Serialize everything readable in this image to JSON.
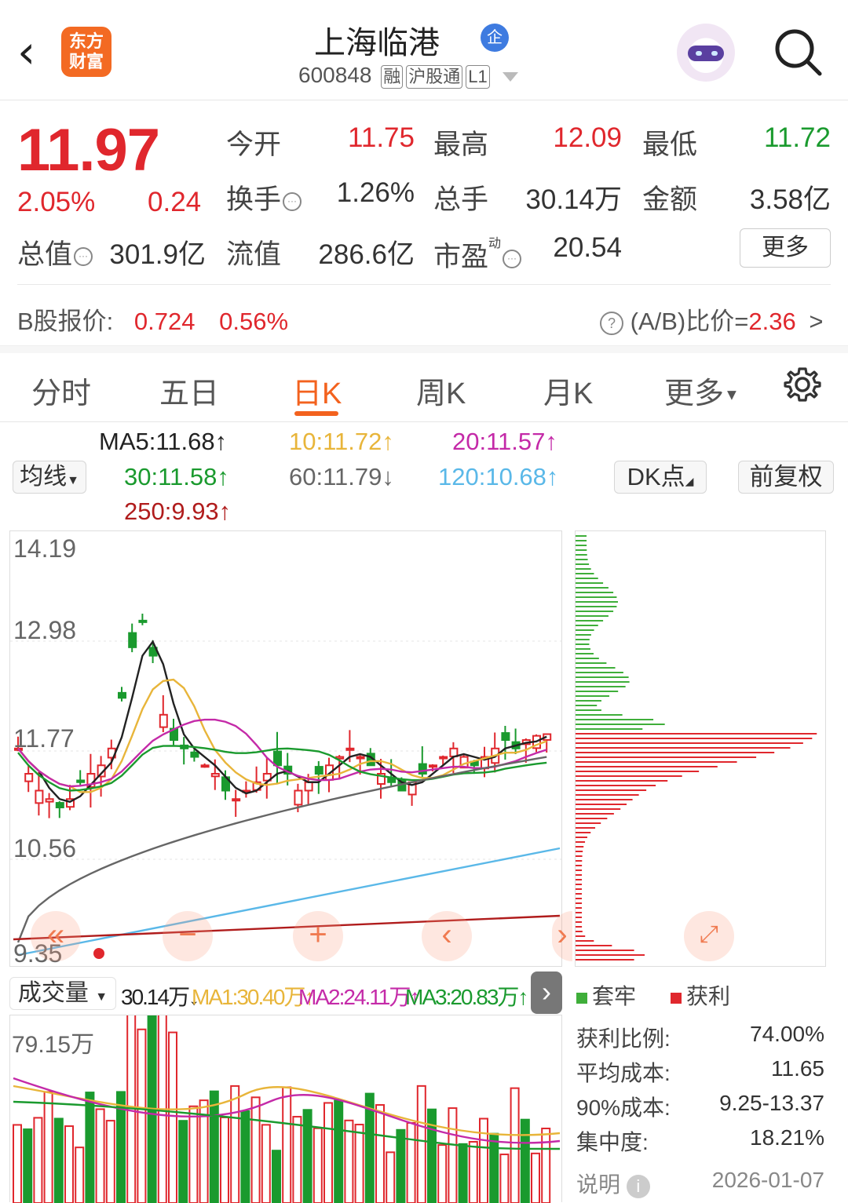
{
  "header": {
    "back_icon": "chevron-left-icon",
    "logo_line1": "东方",
    "logo_line2": "财富",
    "stock_name": "上海临港",
    "qi_badge": "企",
    "code": "600848",
    "tags": [
      "融",
      "沪股通",
      "L1"
    ]
  },
  "quote": {
    "price": "11.97",
    "change_pct": "2.05%",
    "change": "0.24",
    "fields": {
      "open_label": "今开",
      "open": "11.75",
      "high_label": "最高",
      "high": "12.09",
      "low_label": "最低",
      "low": "11.72",
      "turnover_label": "换手",
      "turnover": "1.26%",
      "volume_label": "总手",
      "volume": "30.14万",
      "amount_label": "金额",
      "amount": "3.58亿",
      "mcap_label": "总值",
      "mcap": "301.9亿",
      "float_label": "流值",
      "float": "286.6亿",
      "pe_label": "市盈",
      "pe_sup": "动",
      "pe": "20.54"
    },
    "more_button": "更多",
    "b_label": "B股报价:",
    "b_price": "0.724",
    "b_pct": "0.56%",
    "ab_label": "(A/B)比价=",
    "ab_value": "2.36",
    "ab_arrow": ">"
  },
  "tabs": [
    "分时",
    "五日",
    "日K",
    "周K",
    "月K",
    "更多"
  ],
  "active_tab": "日K",
  "ma": {
    "selector": "均线",
    "ma5": "MA5:11.68↑",
    "ma10": "10:11.72↑",
    "ma20": "20:11.57↑",
    "ma30": "30:11.58↑",
    "ma60": "60:11.79↓",
    "ma120": "120:10.68↑",
    "ma250": "250:9.93↑",
    "dk_button": "DK点",
    "adjust_button": "前复权"
  },
  "colors": {
    "up": "#e0272d",
    "down": "#1a9a2e",
    "accent": "#f3621e",
    "ma5": "#222222",
    "ma10": "#e8b53a",
    "ma20": "#c42aa8",
    "ma30": "#1a9a2e",
    "ma60": "#666666",
    "ma120": "#5ab8e8",
    "ma250": "#b01c1c"
  },
  "kchart": {
    "y_labels": [
      "14.19",
      "12.98",
      "11.77",
      "10.56",
      "9.35"
    ]
  },
  "volume": {
    "selector": "成交量",
    "vol": "30.14万↓",
    "ma1": "MA1:30.40万↑",
    "ma2": "MA2:24.11万↑",
    "ma3": "MA3:20.83万↑",
    "y_label": "79.15万"
  },
  "chips": {
    "legend_trapped": "套牢",
    "legend_profit": "获利",
    "rows": [
      {
        "label": "获利比例:",
        "value": "74.00%"
      },
      {
        "label": "平均成本:",
        "value": "11.65"
      },
      {
        "label": "90%成本:",
        "value": "9.25-13.37"
      },
      {
        "label": "集中度:",
        "value": "18.21%"
      }
    ],
    "explain": "说明",
    "date": "2026-01-07"
  }
}
